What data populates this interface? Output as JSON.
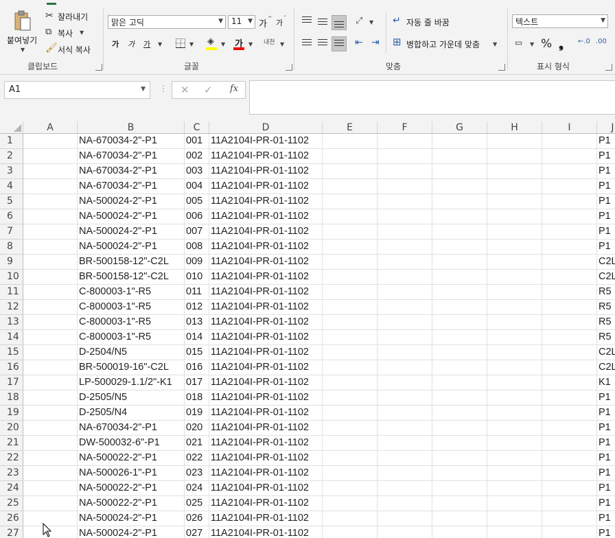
{
  "ribbon": {
    "clipboard": {
      "paste_label": "붙여넣기",
      "cut_label": "잘라내기",
      "copy_label": "복사",
      "format_painter_label": "서식 복사",
      "group_label": "클립보드"
    },
    "font": {
      "font_name": "맑은 고딕",
      "font_size": "11",
      "grow_label": "가",
      "shrink_label": "가",
      "bold_label": "가",
      "italic_label": "가",
      "underline_label": "가",
      "font_color_label": "가",
      "phonetic_label": "내천",
      "group_label": "글꼴",
      "highlight_color": "#ffff00",
      "font_color": "#ff0000"
    },
    "alignment": {
      "wrap_label": "자동 줄 바꿈",
      "merge_label": "병합하고 가운데 맞춤",
      "group_label": "맞춤"
    },
    "number": {
      "format_value": "텍스트",
      "percent_label": "%",
      "comma_label": "❟",
      "group_label": "표시 형식"
    }
  },
  "formula_bar": {
    "name_box": "A1",
    "fx_label": "fx",
    "formula": ""
  },
  "columns": [
    "A",
    "B",
    "C",
    "D",
    "E",
    "F",
    "G",
    "H",
    "I",
    "J"
  ],
  "rows": [
    {
      "num": "1",
      "b": "NA-670034-2\"-P1",
      "c": "001",
      "d": "11A2104I-PR-01-1102",
      "j": "P1"
    },
    {
      "num": "2",
      "b": "NA-670034-2\"-P1",
      "c": "002",
      "d": "11A2104I-PR-01-1102",
      "j": "P1"
    },
    {
      "num": "3",
      "b": "NA-670034-2\"-P1",
      "c": "003",
      "d": "11A2104I-PR-01-1102",
      "j": "P1"
    },
    {
      "num": "4",
      "b": "NA-670034-2\"-P1",
      "c": "004",
      "d": "11A2104I-PR-01-1102",
      "j": "P1"
    },
    {
      "num": "5",
      "b": "NA-500024-2\"-P1",
      "c": "005",
      "d": "11A2104I-PR-01-1102",
      "j": "P1"
    },
    {
      "num": "6",
      "b": "NA-500024-2\"-P1",
      "c": "006",
      "d": "11A2104I-PR-01-1102",
      "j": "P1"
    },
    {
      "num": "7",
      "b": "NA-500024-2\"-P1",
      "c": "007",
      "d": "11A2104I-PR-01-1102",
      "j": "P1"
    },
    {
      "num": "8",
      "b": "NA-500024-2\"-P1",
      "c": "008",
      "d": "11A2104I-PR-01-1102",
      "j": "P1"
    },
    {
      "num": "9",
      "b": "BR-500158-12\"-C2L",
      "c": "009",
      "d": "11A2104I-PR-01-1102",
      "j": "C2L"
    },
    {
      "num": "10",
      "b": "BR-500158-12\"-C2L",
      "c": "010",
      "d": "11A2104I-PR-01-1102",
      "j": "C2L"
    },
    {
      "num": "11",
      "b": "C-800003-1\"-R5",
      "c": "011",
      "d": "11A2104I-PR-01-1102",
      "j": "R5"
    },
    {
      "num": "12",
      "b": "C-800003-1\"-R5",
      "c": "012",
      "d": "11A2104I-PR-01-1102",
      "j": "R5"
    },
    {
      "num": "13",
      "b": "C-800003-1\"-R5",
      "c": "013",
      "d": "11A2104I-PR-01-1102",
      "j": "R5"
    },
    {
      "num": "14",
      "b": "C-800003-1\"-R5",
      "c": "014",
      "d": "11A2104I-PR-01-1102",
      "j": "R5"
    },
    {
      "num": "15",
      "b": "D-2504/N5",
      "c": "015",
      "d": "11A2104I-PR-01-1102",
      "j": "C2L"
    },
    {
      "num": "16",
      "b": "BR-500019-16\"-C2L",
      "c": "016",
      "d": "11A2104I-PR-01-1102",
      "j": "C2L"
    },
    {
      "num": "17",
      "b": "LP-500029-1.1/2\"-K1",
      "c": "017",
      "d": "11A2104I-PR-01-1102",
      "j": "K1"
    },
    {
      "num": "18",
      "b": "D-2505/N5",
      "c": "018",
      "d": "11A2104I-PR-01-1102",
      "j": "P1"
    },
    {
      "num": "19",
      "b": "D-2505/N4",
      "c": "019",
      "d": "11A2104I-PR-01-1102",
      "j": "P1"
    },
    {
      "num": "20",
      "b": "NA-670034-2\"-P1",
      "c": "020",
      "d": "11A2104I-PR-01-1102",
      "j": "P1"
    },
    {
      "num": "21",
      "b": "DW-500032-6\"-P1",
      "c": "021",
      "d": "11A2104I-PR-01-1102",
      "j": "P1"
    },
    {
      "num": "22",
      "b": "NA-500022-2\"-P1",
      "c": "022",
      "d": "11A2104I-PR-01-1102",
      "j": "P1"
    },
    {
      "num": "23",
      "b": "NA-500026-1\"-P1",
      "c": "023",
      "d": "11A2104I-PR-01-1102",
      "j": "P1"
    },
    {
      "num": "24",
      "b": "NA-500022-2\"-P1",
      "c": "024",
      "d": "11A2104I-PR-01-1102",
      "j": "P1"
    },
    {
      "num": "25",
      "b": "NA-500022-2\"-P1",
      "c": "025",
      "d": "11A2104I-PR-01-1102",
      "j": "P1"
    },
    {
      "num": "26",
      "b": "NA-500024-2\"-P1",
      "c": "026",
      "d": "11A2104I-PR-01-1102",
      "j": "P1"
    },
    {
      "num": "27",
      "b": "NA-500024-2\"-P1",
      "c": "027",
      "d": "11A2104I-PR-01-1102",
      "j": "P1"
    }
  ]
}
